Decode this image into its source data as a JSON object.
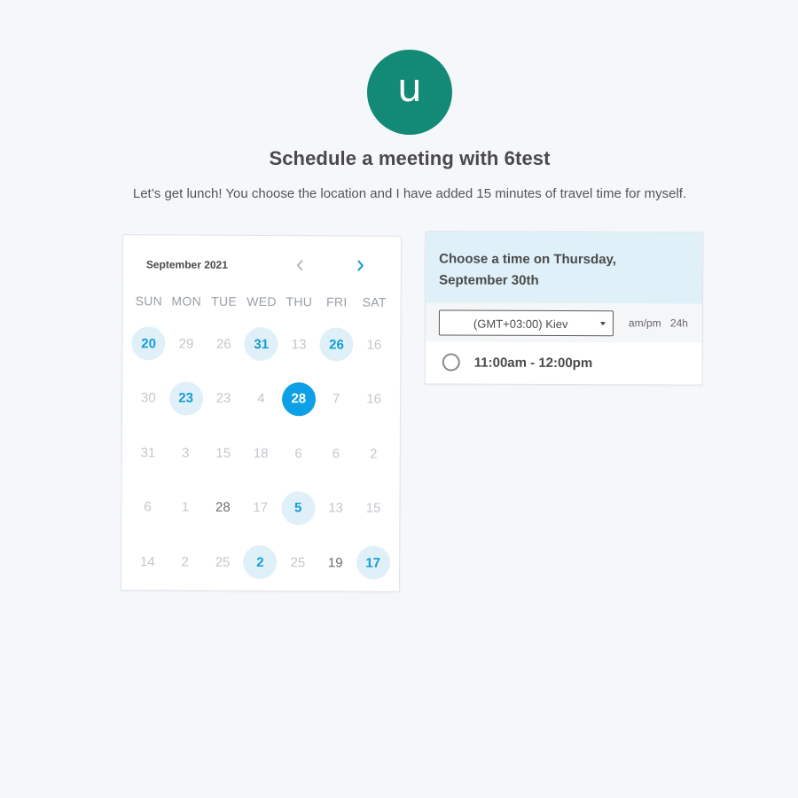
{
  "header": {
    "avatar_letter": "u",
    "title": "Schedule a meeting with 6test",
    "subtitle": "Let’s get lunch! You choose the location and I have added 15 minutes of travel time for myself."
  },
  "calendar": {
    "month_label": "September 2021",
    "prev_icon": "chevron-left-icon",
    "next_icon": "chevron-right-icon",
    "weekdays": [
      "SUN",
      "MON",
      "TUE",
      "WED",
      "THU",
      "FRI",
      "SAT"
    ],
    "rows": [
      [
        {
          "d": "20",
          "s": "available"
        },
        {
          "d": "29",
          "s": "muted"
        },
        {
          "d": "26",
          "s": "muted"
        },
        {
          "d": "31",
          "s": "available"
        },
        {
          "d": "13",
          "s": "muted"
        },
        {
          "d": "26",
          "s": "available"
        },
        {
          "d": "16",
          "s": "muted"
        }
      ],
      [
        {
          "d": "30",
          "s": "muted"
        },
        {
          "d": "23",
          "s": "available"
        },
        {
          "d": "23",
          "s": "muted"
        },
        {
          "d": "4",
          "s": "muted"
        },
        {
          "d": "28",
          "s": "selected"
        },
        {
          "d": "7",
          "s": "muted"
        },
        {
          "d": "16",
          "s": "muted"
        }
      ],
      [
        {
          "d": "31",
          "s": "muted"
        },
        {
          "d": "3",
          "s": "muted"
        },
        {
          "d": "15",
          "s": "muted"
        },
        {
          "d": "18",
          "s": "muted"
        },
        {
          "d": "6",
          "s": "muted"
        },
        {
          "d": "6",
          "s": "muted"
        },
        {
          "d": "2",
          "s": "muted"
        }
      ],
      [
        {
          "d": "6",
          "s": "muted"
        },
        {
          "d": "1",
          "s": "muted"
        },
        {
          "d": "28",
          "s": "dark"
        },
        {
          "d": "17",
          "s": "muted"
        },
        {
          "d": "5",
          "s": "available"
        },
        {
          "d": "13",
          "s": "muted"
        },
        {
          "d": "15",
          "s": "muted"
        }
      ],
      [
        {
          "d": "14",
          "s": "muted"
        },
        {
          "d": "2",
          "s": "muted"
        },
        {
          "d": "25",
          "s": "muted"
        },
        {
          "d": "2",
          "s": "available"
        },
        {
          "d": "25",
          "s": "muted"
        },
        {
          "d": "19",
          "s": "dark"
        },
        {
          "d": "17",
          "s": "available"
        }
      ]
    ]
  },
  "time_panel": {
    "title": "Choose a time on Thursday, September 30th",
    "timezone": "(GMT+03:00) Kiev",
    "format_ampm": "am/pm",
    "format_24h": "24h",
    "slots": [
      {
        "label": "11:00am - 12:00pm"
      }
    ]
  },
  "colors": {
    "accent": "#0ea0e6",
    "available_bg": "#dff0f8",
    "avatar_bg": "#128a76",
    "page_bg": "#f5f7fb"
  }
}
